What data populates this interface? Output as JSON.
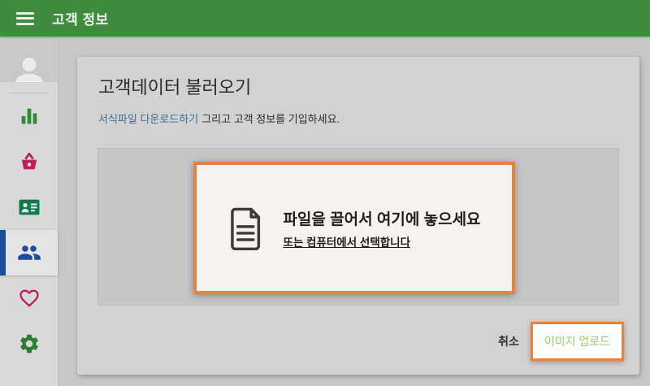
{
  "header": {
    "title": "고객 정보"
  },
  "sidebar": {
    "items": [
      {
        "icon": "bar-chart-icon",
        "color": "#2f8a32",
        "selected": false
      },
      {
        "icon": "basket-icon",
        "color": "#bf1f5a",
        "selected": false
      },
      {
        "icon": "contact-card-icon",
        "color": "#117a4f",
        "selected": false
      },
      {
        "icon": "people-icon",
        "color": "#1c4d9d",
        "selected": true
      },
      {
        "icon": "heart-icon",
        "color": "#bf1f5a",
        "selected": false
      },
      {
        "icon": "gear-icon",
        "color": "#2c7d31",
        "selected": false
      }
    ]
  },
  "main": {
    "card_title": "고객데이터 불러오기",
    "instructions": {
      "link_text": "서식파일 다운로드하기",
      "rest_text": "그리고 고객 정보를 기입하세요."
    },
    "dropzone": {
      "primary_text": "파일을 끌어서 여기에 놓으세요",
      "browse_link_text": "또는 컴퓨터에서 선택합니다"
    },
    "actions": {
      "cancel_label": "취소",
      "upload_label": "이미지 업로드"
    }
  },
  "colors": {
    "header_green": "#3e8c3e",
    "highlight_orange": "#e8823c",
    "selected_item_blue": "#1c4d9d",
    "instruction_link_blue": "#3c6f93",
    "upload_label_green": "#9bd171"
  }
}
